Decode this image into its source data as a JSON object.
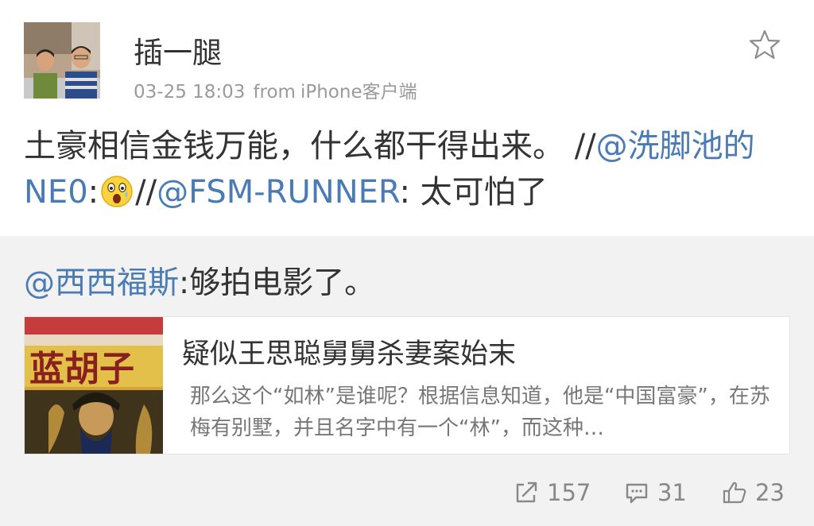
{
  "post": {
    "username": "插一腿",
    "time": "03-25 18:03",
    "source_label": "from",
    "source": "iPhone客户端",
    "text": {
      "p1": "土豪相信金钱万能，什么都干得出来。 //",
      "m1": "@洗脚池的NE0",
      "p2": ":",
      "emoji": "surprised-face-emoji",
      "p3": "//",
      "m2": "@FSM-RUNNER",
      "p4": ": 太可怕了"
    }
  },
  "repost": {
    "mention": "@西西福斯",
    "text": ":够拍电影了。",
    "card": {
      "thumb_title": "蓝胡子",
      "title": "疑似王思聪舅舅杀妻案始末",
      "excerpt": "那么这个“如林”是谁呢？根据信息知道，他是“中国富豪”，在苏梅有别墅，并且名字中有一个“林”，而这种…"
    }
  },
  "actions": {
    "repost_count": "157",
    "comment_count": "31",
    "like_count": "23"
  },
  "icons": {
    "favorite": "star-outline-icon",
    "repost": "share-arrow-icon",
    "comment": "comment-bubble-icon",
    "like": "thumbs-up-icon"
  },
  "colors": {
    "mention": "#4a7bb5",
    "meta": "#9a9a9a",
    "repost_bg": "#f2f2f2",
    "action": "#888888"
  }
}
